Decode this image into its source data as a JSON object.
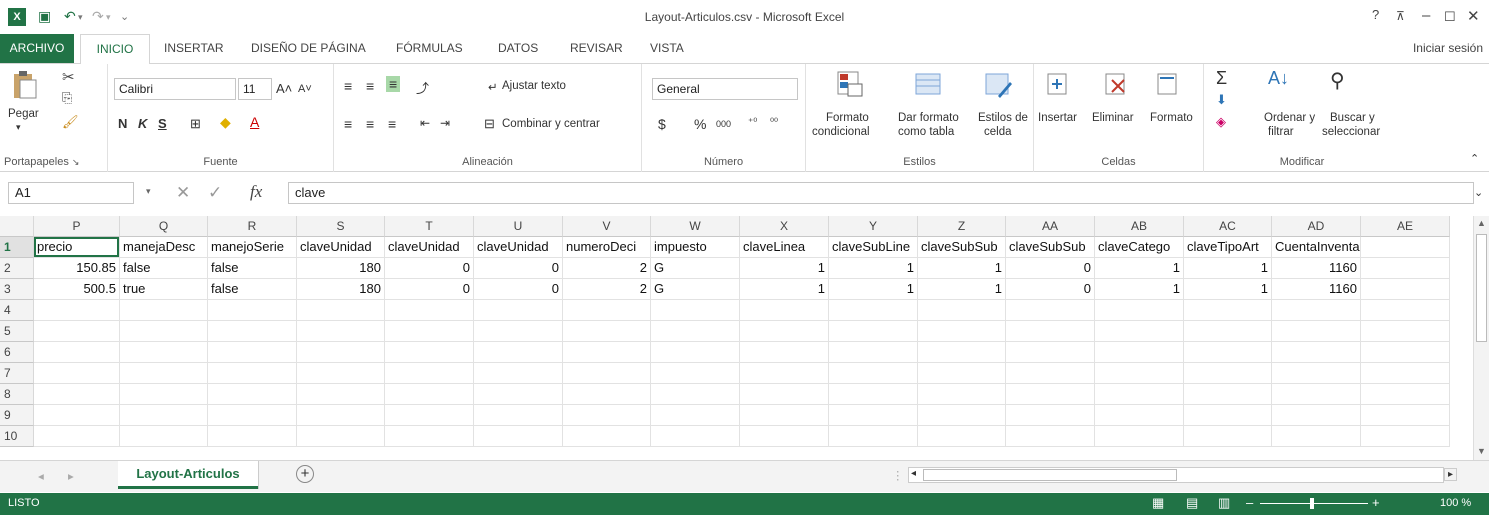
{
  "window": {
    "title": "Layout-Articulos.csv - Microsoft Excel",
    "help": "?",
    "minimize": "–",
    "maximize": "☐",
    "close": "✕"
  },
  "tabs": {
    "archivo": "ARCHIVO",
    "inicio": "INICIO",
    "insertar": "INSERTAR",
    "diseno": "DISEÑO DE PÁGINA",
    "formulas": "FÓRMULAS",
    "datos": "DATOS",
    "revisar": "REVISAR",
    "vista": "VISTA",
    "signin": "Iniciar sesión"
  },
  "ribbon": {
    "portapapeles": {
      "label": "Portapapeles",
      "pegar": "Pegar"
    },
    "fuente": {
      "label": "Fuente",
      "font_name": "Calibri",
      "font_size": "11",
      "bold": "N",
      "italic": "K",
      "underline": "S"
    },
    "alineacion": {
      "label": "Alineación",
      "ajustar": "Ajustar texto",
      "combinar": "Combinar y centrar"
    },
    "numero": {
      "label": "Número",
      "format": "General",
      "currency": "$",
      "percent": "%",
      "thousands": "000"
    },
    "estilos": {
      "label": "Estilos",
      "formato_cond_1": "Formato",
      "formato_cond_2": "condicional",
      "dar_formato_1": "Dar formato",
      "dar_formato_2": "como tabla",
      "estilos_celda_1": "Estilos de",
      "estilos_celda_2": "celda"
    },
    "celdas": {
      "label": "Celdas",
      "insertar": "Insertar",
      "eliminar": "Eliminar",
      "formato": "Formato"
    },
    "modificar": {
      "label": "Modificar",
      "ordenar_1": "Ordenar y",
      "ordenar_2": "filtrar",
      "buscar_1": "Buscar y",
      "buscar_2": "seleccionar"
    }
  },
  "formula_bar": {
    "name_box": "A1",
    "fx": "fx",
    "content": "clave"
  },
  "grid": {
    "columns": [
      "P",
      "Q",
      "R",
      "S",
      "T",
      "U",
      "V",
      "W",
      "X",
      "Y",
      "Z",
      "AA",
      "AB",
      "AC",
      "AD",
      "AE"
    ],
    "rows": [
      "1",
      "2",
      "3",
      "4",
      "5",
      "6",
      "7",
      "8",
      "9",
      "10"
    ],
    "header_row": [
      "precio",
      "manejaDesc",
      "manejoSerie",
      "claveUnidad",
      "claveUnidad",
      "claveUnidad",
      "numeroDeci",
      "impuesto",
      "claveLinea",
      "claveSubLine",
      "claveSubSub",
      "claveSubSub",
      "claveCatego",
      "claveTipoArt",
      "CuentaInventario",
      ""
    ],
    "data_rows": [
      [
        "150.85",
        "false",
        "false",
        "180",
        "0",
        "0",
        "2",
        "G",
        "1",
        "1",
        "1",
        "0",
        "1",
        "1",
        "1160",
        ""
      ],
      [
        "500.5",
        "true",
        "false",
        "180",
        "0",
        "0",
        "2",
        "G",
        "1",
        "1",
        "1",
        "0",
        "1",
        "1",
        "1160",
        ""
      ]
    ]
  },
  "sheets": {
    "active": "Layout-Articulos",
    "add": "+"
  },
  "status": {
    "ready": "LISTO",
    "zoom": "100 %"
  },
  "colors": {
    "accent": "#217346",
    "status_bg": "#217346"
  }
}
